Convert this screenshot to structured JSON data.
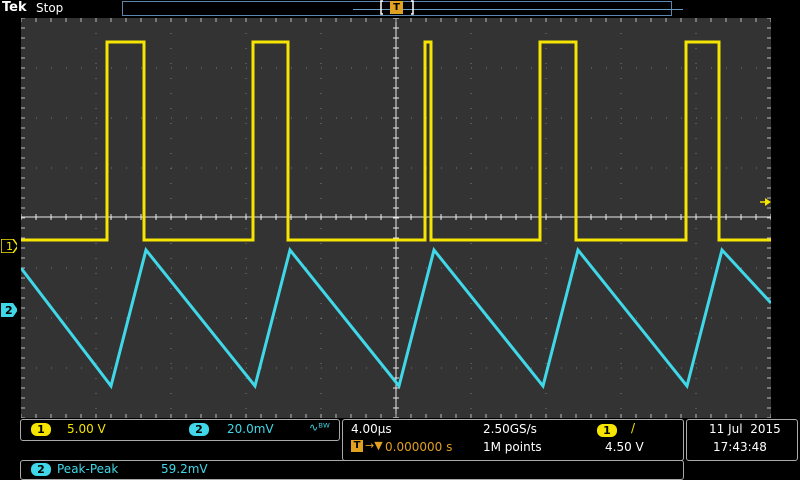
{
  "header": {
    "brand": "Tek",
    "acquisition_state": "Stop",
    "trigger_marker": "T"
  },
  "channels": [
    {
      "id": "1",
      "label": "1",
      "scale": "5.00 V",
      "color": "#f5e500"
    },
    {
      "id": "2",
      "label": "2",
      "scale": "20.0mV",
      "coupling_icon": "bandwidth-limit-icon",
      "coupling_glyph": "∿ᴮᵂ",
      "color": "#40d8e8"
    }
  ],
  "timebase": {
    "horizontal_scale": "4.00µs",
    "sample_rate": "2.50GS/s",
    "delay": "0.000000 s",
    "record_length": "1M points"
  },
  "trigger": {
    "source": "1",
    "slope_glyph": "/",
    "level": "4.50 V"
  },
  "datetime": {
    "date": "11 Jul  2015",
    "time": "17:43:48"
  },
  "measurement": {
    "channel": "2",
    "type": "Peak-Peak",
    "value": "59.2mV"
  },
  "colors": {
    "ch1": "#f5e500",
    "ch2": "#40d8e8",
    "trigger": "#e0a020",
    "graticule": "#333333"
  }
}
